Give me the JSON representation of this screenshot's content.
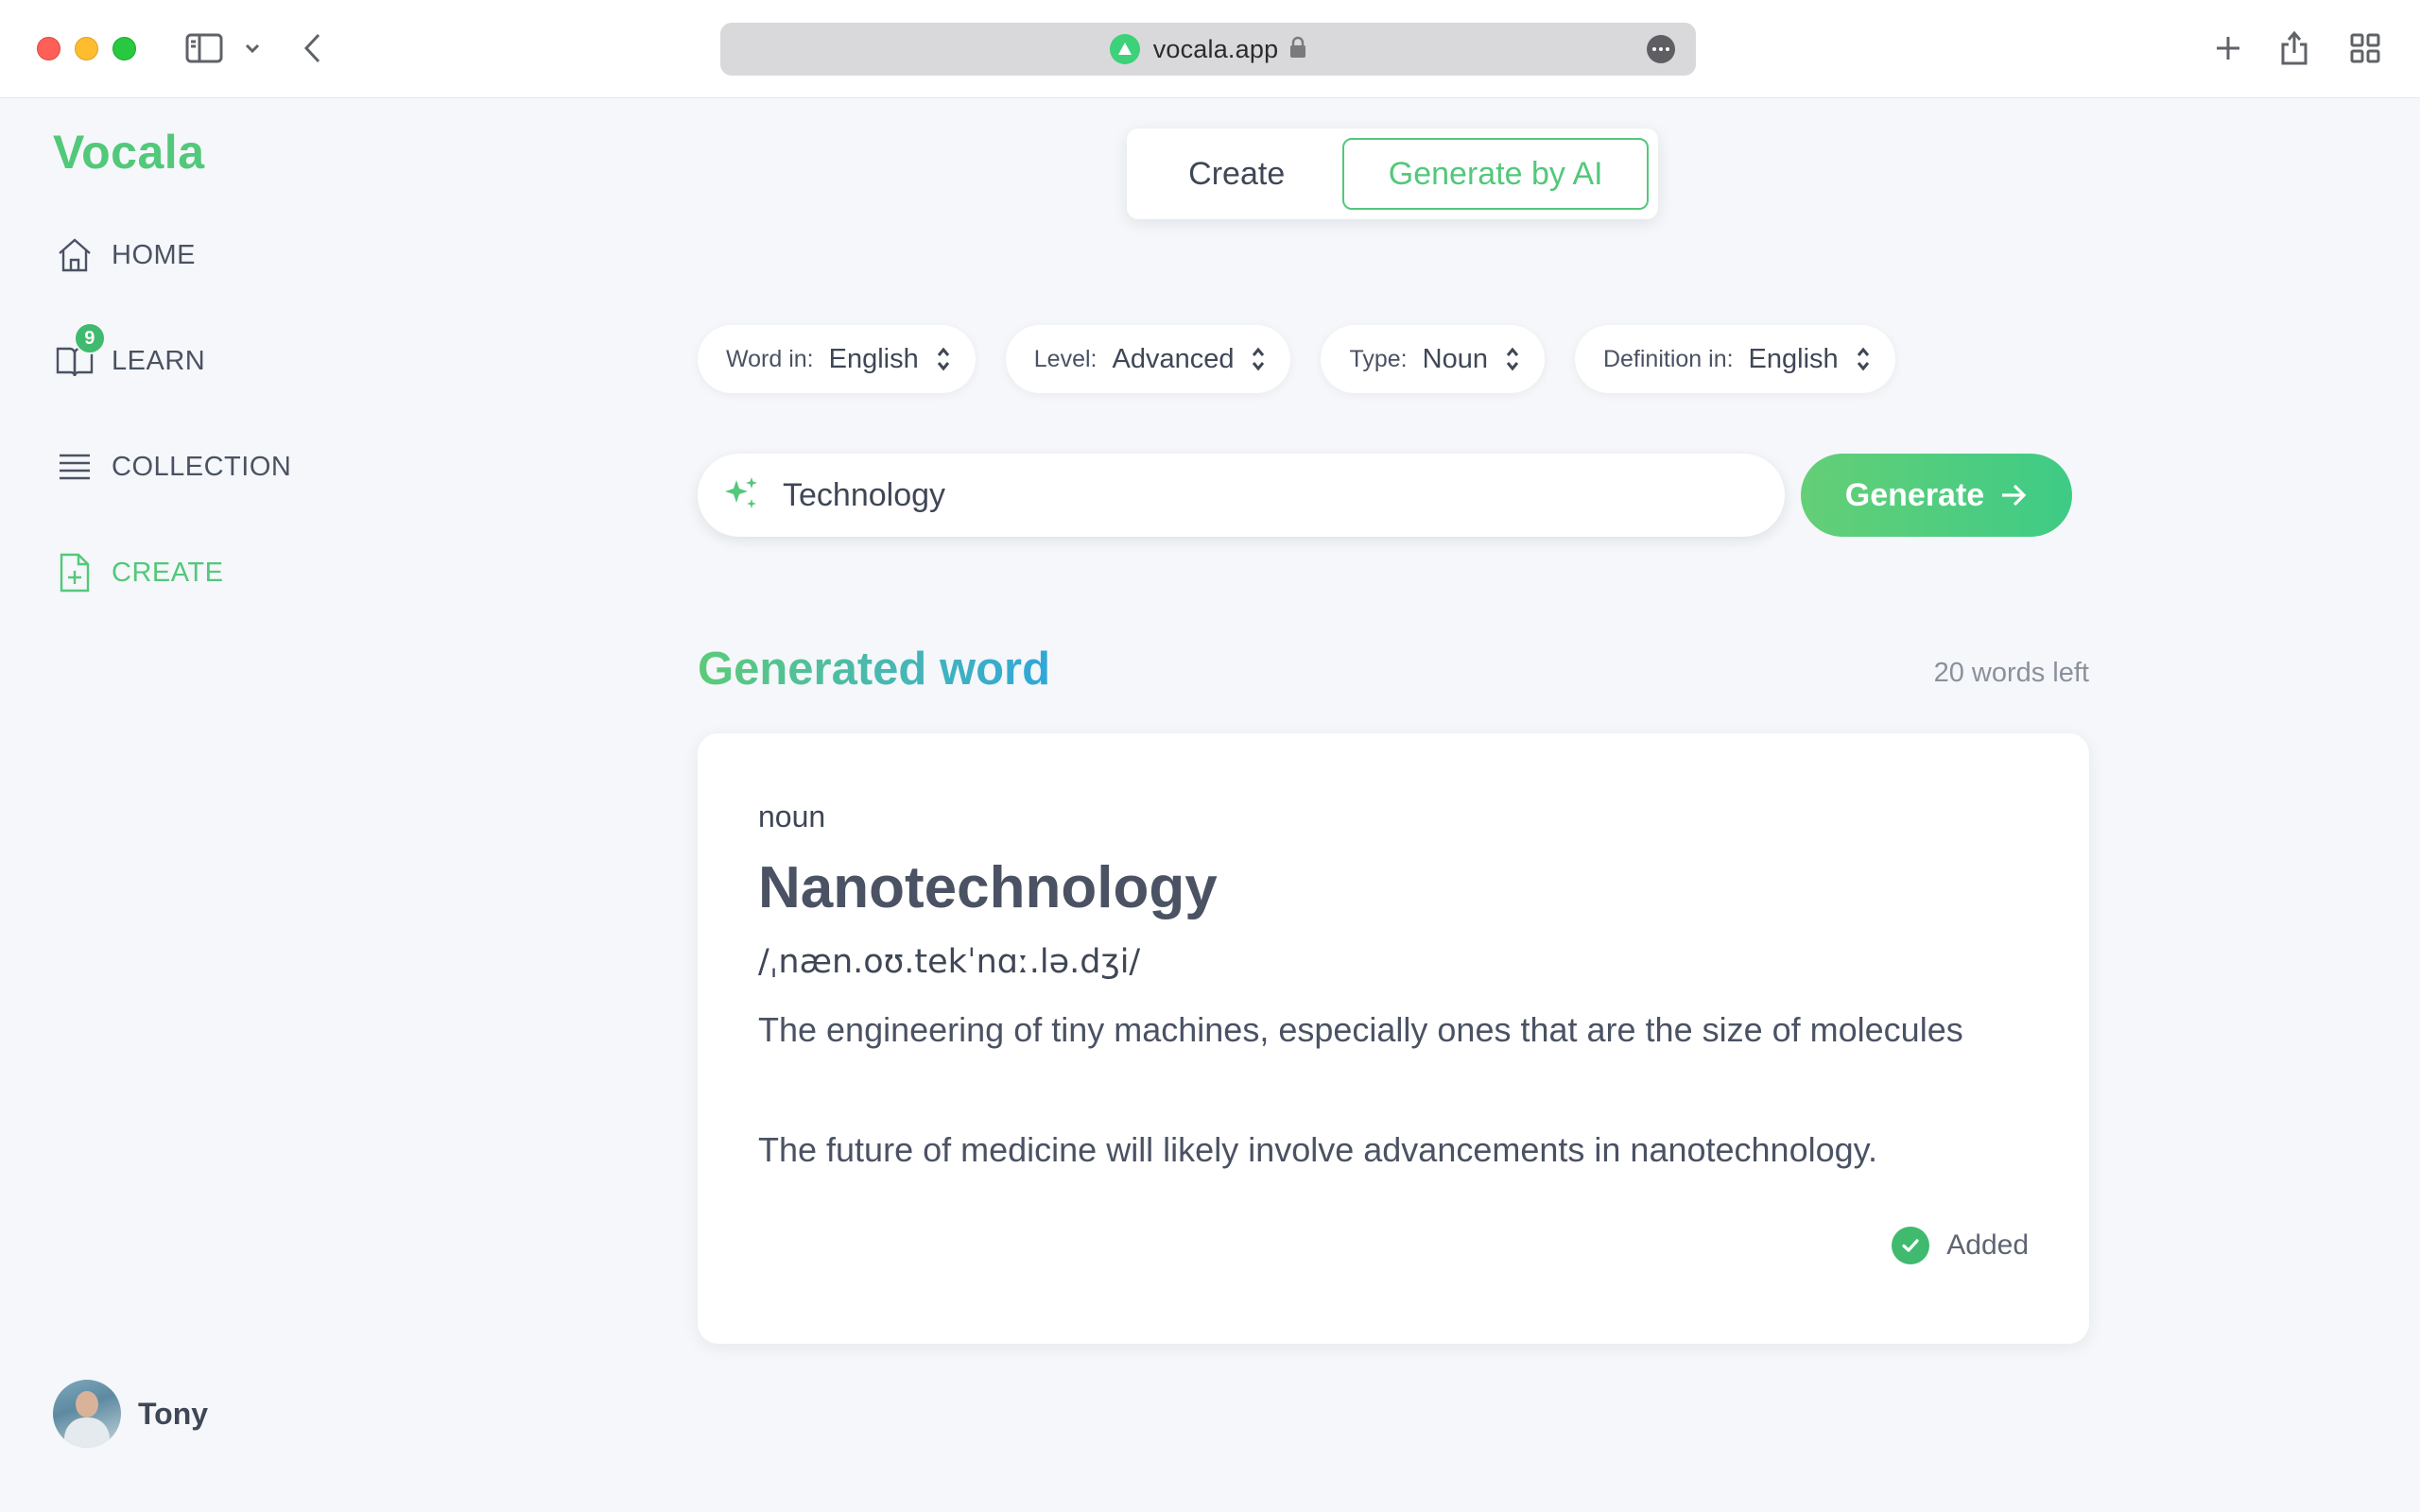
{
  "browser": {
    "url": "vocala.app"
  },
  "sidebar": {
    "brand": "Vocala",
    "items": [
      {
        "label": "HOME",
        "icon": "home-icon"
      },
      {
        "label": "LEARN",
        "icon": "book-icon",
        "badge": "9"
      },
      {
        "label": "COLLECTION",
        "icon": "list-icon"
      },
      {
        "label": "CREATE",
        "icon": "file-plus-icon",
        "active": true
      }
    ],
    "user": {
      "name": "Tony"
    }
  },
  "mode_switch": {
    "create_label": "Create",
    "ai_label": "Generate by AI",
    "selected": "Generate by AI"
  },
  "filters": [
    {
      "label": "Word in:",
      "value": "English"
    },
    {
      "label": "Level:",
      "value": "Advanced"
    },
    {
      "label": "Type:",
      "value": "Noun"
    },
    {
      "label": "Definition in:",
      "value": "English"
    }
  ],
  "prompt": {
    "value": "Technology",
    "icon": "sparkles-icon"
  },
  "generate_button": {
    "label": "Generate",
    "icon": "arrow-right-icon"
  },
  "result": {
    "title": "Generated word",
    "words_left": "20 words left",
    "part_of_speech": "noun",
    "word": "Nanotechnology",
    "ipa": "/ˌnæn.oʊ.tekˈnɑː.lə.dʒi/",
    "definition": "The engineering of tiny machines, especially ones that are the size of molecules",
    "example": "The future of medicine will likely involve advancements in nanotechnology.",
    "status": "Added"
  },
  "colors": {
    "accent": "#52c87a",
    "title_gradient_start": "#5ccb77",
    "title_gradient_end": "#2fa7d9",
    "background": "#f5f7fa"
  }
}
